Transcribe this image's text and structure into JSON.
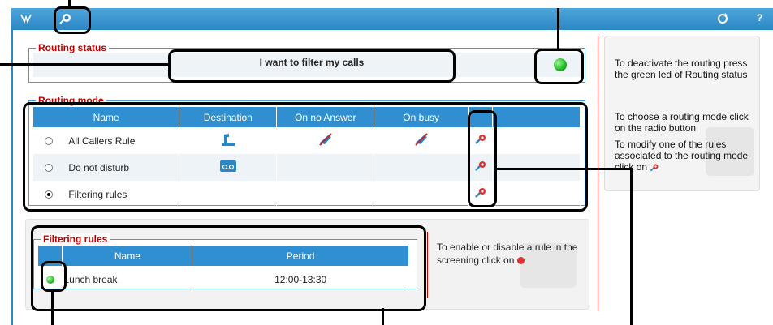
{
  "topbar": {
    "icons": [
      "routing-logo-icon",
      "routing-settings-icon",
      "refresh-icon",
      "help-icon"
    ],
    "help_label": "?"
  },
  "routing_status": {
    "legend": "Routing status",
    "button_label": "I want to filter my calls",
    "led_color": "#1fb81f"
  },
  "routing_mode": {
    "legend": "Routing mode",
    "columns": [
      "Name",
      "Destination",
      "On no Answer",
      "On busy",
      ""
    ],
    "rows": [
      {
        "name": "All Callers Rule",
        "selected": false,
        "destination_icon": "desk-phone-icon",
        "no_answer_icon": "disabled-forward-icon",
        "busy_icon": "disabled-forward-icon",
        "edit_icon": "edit-rule-icon"
      },
      {
        "name": "Do not disturb",
        "selected": false,
        "destination_icon": "voicemail-icon",
        "no_answer_icon": "",
        "busy_icon": "",
        "edit_icon": "edit-rule-icon"
      },
      {
        "name": "Filtering rules",
        "selected": true,
        "destination_icon": "",
        "no_answer_icon": "",
        "busy_icon": "",
        "edit_icon": "edit-rule-icon"
      }
    ]
  },
  "filtering_rules": {
    "legend": "Filtering rules",
    "columns": [
      "Name",
      "Period"
    ],
    "rows": [
      {
        "enabled": true,
        "name": "Lunch break",
        "period": "12:00-13:30"
      }
    ],
    "hint": "To enable or disable a rule in the screening click on"
  },
  "side_panel": {
    "text1": "To deactivate the routing press the green led of Routing status",
    "text2": "To choose a routing mode click on the radio button",
    "text3": "To modify one of the rules associated to the routing mode click on"
  },
  "colors": {
    "header_blue": "#2f8fd0",
    "legend_red": "#c00000",
    "led_green": "#1fb81f"
  }
}
